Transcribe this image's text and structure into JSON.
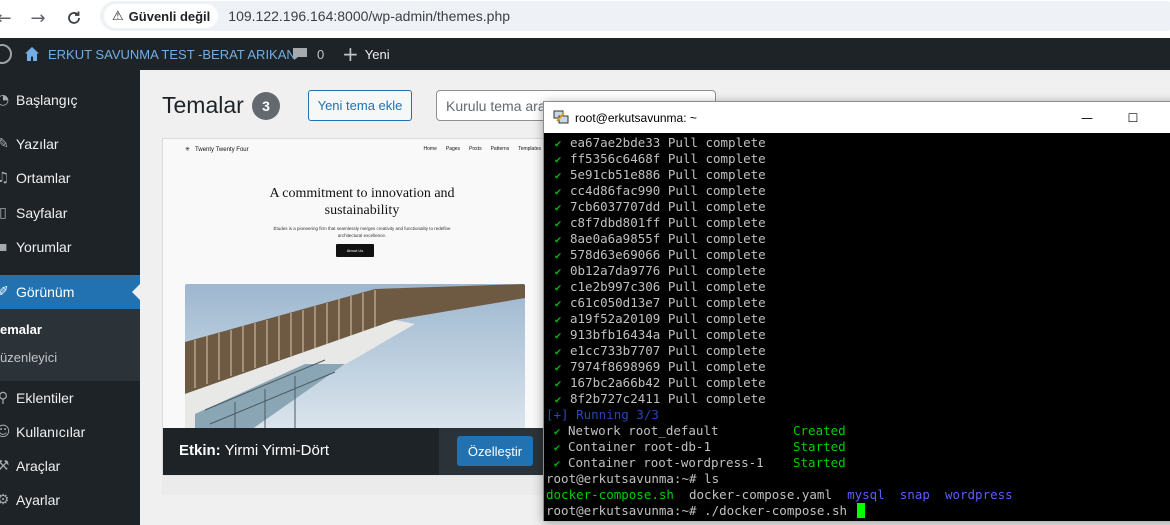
{
  "browser": {
    "security_label": "Güvenli değil",
    "url": "109.122.196.164:8000/wp-admin/themes.php",
    "icons": [
      "back-icon",
      "forward-icon",
      "reload-icon",
      "warning-icon"
    ]
  },
  "adminbar": {
    "site_name": "ERKUT SAVUNMA TEST -BERAT ARIKAN",
    "comments_count": "0",
    "new_label": "Yeni"
  },
  "sidebar": {
    "items": [
      {
        "label": "Başlangıç",
        "icon": "dashboard-icon"
      },
      {
        "label": "Yazılar",
        "icon": "pin-icon"
      },
      {
        "label": "Ortamlar",
        "icon": "media-icon"
      },
      {
        "label": "Sayfalar",
        "icon": "page-icon"
      },
      {
        "label": "Yorumlar",
        "icon": "comment-icon"
      },
      {
        "label": "Görünüm",
        "icon": "appearance-icon",
        "active": true
      },
      {
        "label": "Eklentiler",
        "icon": "plugin-icon"
      },
      {
        "label": "Kullanıcılar",
        "icon": "users-icon"
      },
      {
        "label": "Araçlar",
        "icon": "tools-icon"
      },
      {
        "label": "Ayarlar",
        "icon": "settings-icon"
      }
    ],
    "submenu": [
      {
        "label": "emalar",
        "current": true
      },
      {
        "label": "üzenleyici"
      }
    ]
  },
  "main": {
    "title": "Temalar",
    "count": "3",
    "add_button": "Yeni tema ekle",
    "search_placeholder": "Kurulu tema ara"
  },
  "theme": {
    "screenshot": {
      "brand": "Twenty Twenty Four",
      "nav": [
        "Home",
        "Pages",
        "Posts",
        "Patterns",
        "Templates"
      ],
      "headline": "A commitment to innovation and sustainability",
      "body": "Études is a pioneering firm that seamlessly merges creativity and functionality to redefine architectural excellence.",
      "button": "About Us"
    },
    "active_prefix": "Etkin:",
    "active_name": "Yirmi Yirmi-Dört",
    "customize_button": "Özelleştir"
  },
  "terminal": {
    "title": "root@erkutsavunma: ~",
    "pulls": [
      "ea67ae2bde33 Pull complete",
      "ff5356c6468f Pull complete",
      "5e91cb51e886 Pull complete",
      "cc4d86fac990 Pull complete",
      "7cb6037707dd Pull complete",
      "c8f7dbd801ff Pull complete",
      "8ae0a6a9855f Pull complete",
      "578d63e69066 Pull complete",
      "0b12a7da9776 Pull complete",
      "c1e2b997c306 Pull complete",
      "c61c050d13e7 Pull complete",
      "a19f52a20109 Pull complete",
      "913bfb16434a Pull complete",
      "e1cc733b7707 Pull complete",
      "7974f8698969 Pull complete",
      "167bc2a66b42 Pull complete",
      "8f2b727c2411 Pull complete"
    ],
    "running": "[+] Running 3/3",
    "results": [
      {
        "name": "Network root_default",
        "status": "Created"
      },
      {
        "name": "Container root-db-1",
        "status": "Started"
      },
      {
        "name": "Container root-wordpress-1",
        "status": "Started"
      }
    ],
    "prompt": "root@erkutsavunma:~#",
    "cmd1": "ls",
    "ls_files": [
      "docker-compose.sh",
      "docker-compose.yaml"
    ],
    "ls_dirs": [
      "mysql",
      "snap",
      "wordpress"
    ],
    "cmd2": "./docker-compose.sh"
  },
  "colors": {
    "wp_blue": "#2271b1",
    "admin_dark": "#1d2327",
    "term_green": "#00cc00",
    "term_blue": "#5c5cff"
  }
}
